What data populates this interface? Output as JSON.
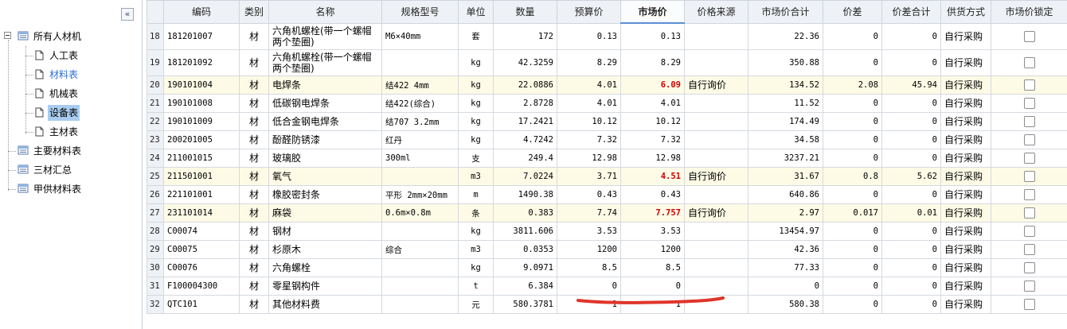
{
  "sidebar": {
    "collapse_label": "«",
    "items": [
      {
        "label": "所有人材机",
        "level": 0,
        "icon": "folder-icon"
      },
      {
        "label": "人工表",
        "level": 1,
        "icon": "document-icon"
      },
      {
        "label": "材料表",
        "level": 1,
        "icon": "document-icon",
        "state": "link"
      },
      {
        "label": "机械表",
        "level": 1,
        "icon": "document-icon"
      },
      {
        "label": "设备表",
        "level": 1,
        "icon": "document-icon",
        "state": "selected"
      },
      {
        "label": "主材表",
        "level": 1,
        "icon": "document-icon"
      },
      {
        "label": "主要材料表",
        "level": 0,
        "icon": "folder-icon"
      },
      {
        "label": "三材汇总",
        "level": 0,
        "icon": "folder-icon"
      },
      {
        "label": "甲供材料表",
        "level": 0,
        "icon": "folder-icon"
      }
    ]
  },
  "grid": {
    "columns": [
      "",
      "编码",
      "类别",
      "名称",
      "规格型号",
      "单位",
      "数量",
      "预算价",
      "市场价",
      "价格来源",
      "市场价合计",
      "价差",
      "价差合计",
      "供货方式",
      "市场价锁定"
    ],
    "active_column": "市场价",
    "rows": [
      {
        "idx": "18",
        "code": "181201007",
        "type": "材",
        "name": "六角机螺栓(带一个螺帽两个垫圈)",
        "spec": "M6×40mm",
        "unit": "套",
        "qty": "172",
        "budget": "0.13",
        "market": "0.13",
        "source": "",
        "total": "22.36",
        "diff": "0",
        "diff_total": "0",
        "supply": "自行采购",
        "locked": false,
        "highlight": false,
        "tall": true,
        "red": false
      },
      {
        "idx": "19",
        "code": "181201092",
        "type": "材",
        "name": "六角机螺栓(带一个螺帽两个垫圈)",
        "spec": "",
        "unit": "kg",
        "qty": "42.3259",
        "budget": "8.29",
        "market": "8.29",
        "source": "",
        "total": "350.88",
        "diff": "0",
        "diff_total": "0",
        "supply": "自行采购",
        "locked": false,
        "highlight": false,
        "tall": true,
        "red": false
      },
      {
        "idx": "20",
        "code": "190101004",
        "type": "材",
        "name": "电焊条",
        "spec": "结422 4mm",
        "unit": "kg",
        "qty": "22.0886",
        "budget": "4.01",
        "market": "6.09",
        "source": "自行询价",
        "total": "134.52",
        "diff": "2.08",
        "diff_total": "45.94",
        "supply": "自行采购",
        "locked": false,
        "highlight": true,
        "tall": false,
        "red": true
      },
      {
        "idx": "21",
        "code": "190101008",
        "type": "材",
        "name": "低碳钢电焊条",
        "spec": "结422(综合)",
        "unit": "kg",
        "qty": "2.8728",
        "budget": "4.01",
        "market": "4.01",
        "source": "",
        "total": "11.52",
        "diff": "0",
        "diff_total": "0",
        "supply": "自行采购",
        "locked": false,
        "highlight": false,
        "tall": false,
        "red": false
      },
      {
        "idx": "22",
        "code": "190101009",
        "type": "材",
        "name": "低合金钢电焊条",
        "spec": "结707 3.2mm",
        "unit": "kg",
        "qty": "17.2421",
        "budget": "10.12",
        "market": "10.12",
        "source": "",
        "total": "174.49",
        "diff": "0",
        "diff_total": "0",
        "supply": "自行采购",
        "locked": false,
        "highlight": false,
        "tall": false,
        "red": false
      },
      {
        "idx": "23",
        "code": "200201005",
        "type": "材",
        "name": "酚醛防锈漆",
        "spec": "红丹",
        "unit": "kg",
        "qty": "4.7242",
        "budget": "7.32",
        "market": "7.32",
        "source": "",
        "total": "34.58",
        "diff": "0",
        "diff_total": "0",
        "supply": "自行采购",
        "locked": false,
        "highlight": false,
        "tall": false,
        "red": false
      },
      {
        "idx": "24",
        "code": "211001015",
        "type": "材",
        "name": "玻璃胶",
        "spec": "300ml",
        "unit": "支",
        "qty": "249.4",
        "budget": "12.98",
        "market": "12.98",
        "source": "",
        "total": "3237.21",
        "diff": "0",
        "diff_total": "0",
        "supply": "自行采购",
        "locked": false,
        "highlight": false,
        "tall": false,
        "red": false
      },
      {
        "idx": "25",
        "code": "211501001",
        "type": "材",
        "name": "氧气",
        "spec": "",
        "unit": "m3",
        "qty": "7.0224",
        "budget": "3.71",
        "market": "4.51",
        "source": "自行询价",
        "total": "31.67",
        "diff": "0.8",
        "diff_total": "5.62",
        "supply": "自行采购",
        "locked": false,
        "highlight": true,
        "tall": false,
        "red": true
      },
      {
        "idx": "26",
        "code": "221101001",
        "type": "材",
        "name": "橡胶密封条",
        "spec": "平形 2mm×20mm",
        "unit": "m",
        "qty": "1490.38",
        "budget": "0.43",
        "market": "0.43",
        "source": "",
        "total": "640.86",
        "diff": "0",
        "diff_total": "0",
        "supply": "自行采购",
        "locked": false,
        "highlight": false,
        "tall": false,
        "red": false
      },
      {
        "idx": "27",
        "code": "231101014",
        "type": "材",
        "name": "麻袋",
        "spec": "0.6m×0.8m",
        "unit": "条",
        "qty": "0.383",
        "budget": "7.74",
        "market": "7.757",
        "source": "自行询价",
        "total": "2.97",
        "diff": "0.017",
        "diff_total": "0.01",
        "supply": "自行采购",
        "locked": false,
        "highlight": true,
        "tall": false,
        "red": true
      },
      {
        "idx": "28",
        "code": "C00074",
        "type": "材",
        "name": "钢材",
        "spec": "",
        "unit": "kg",
        "qty": "3811.606",
        "budget": "3.53",
        "market": "3.53",
        "source": "",
        "total": "13454.97",
        "diff": "0",
        "diff_total": "0",
        "supply": "自行采购",
        "locked": false,
        "highlight": false,
        "tall": false,
        "red": false
      },
      {
        "idx": "29",
        "code": "C00075",
        "type": "材",
        "name": "杉原木",
        "spec": "综合",
        "unit": "m3",
        "qty": "0.0353",
        "budget": "1200",
        "market": "1200",
        "source": "",
        "total": "42.36",
        "diff": "0",
        "diff_total": "0",
        "supply": "自行采购",
        "locked": false,
        "highlight": false,
        "tall": false,
        "red": false
      },
      {
        "idx": "30",
        "code": "C00076",
        "type": "材",
        "name": "六角螺栓",
        "spec": "",
        "unit": "kg",
        "qty": "9.0971",
        "budget": "8.5",
        "market": "8.5",
        "source": "",
        "total": "77.33",
        "diff": "0",
        "diff_total": "0",
        "supply": "自行采购",
        "locked": false,
        "highlight": false,
        "tall": false,
        "red": false
      },
      {
        "idx": "31",
        "code": "F100004300",
        "type": "材",
        "name": "零星钢构件",
        "spec": "",
        "unit": "t",
        "qty": "6.384",
        "budget": "0",
        "market": "0",
        "source": "",
        "total": "0",
        "diff": "0",
        "diff_total": "0",
        "supply": "自行采购",
        "locked": false,
        "highlight": false,
        "tall": false,
        "red": false
      },
      {
        "idx": "32",
        "code": "QTC101",
        "type": "材",
        "name": "其他材料费",
        "spec": "",
        "unit": "元",
        "qty": "580.3781",
        "budget": "1",
        "market": "1",
        "source": "",
        "total": "580.38",
        "diff": "0",
        "diff_total": "0",
        "supply": "自行采购",
        "locked": false,
        "highlight": false,
        "tall": false,
        "red": false
      }
    ]
  },
  "annotation": {
    "underline_color": "#e0352b"
  }
}
